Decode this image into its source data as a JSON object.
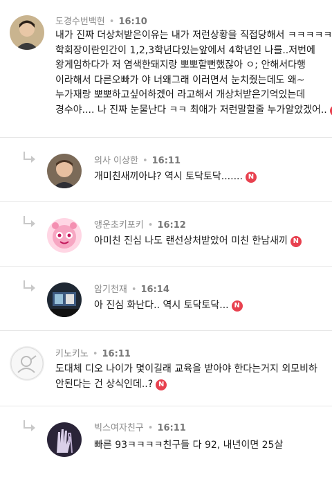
{
  "colors": {
    "badge": "#e8414f",
    "meta": "#8a8a8a",
    "divider": "#e6e6e6"
  },
  "comments": [
    {
      "author": "도경수번백현",
      "time": "16:10",
      "is_reply": false,
      "avatar": "person-photo",
      "lines": [
        "내가 진짜 더상처받은이유는 내가 저런상황을 직접당해서 ㅋㅋㅋㅋㅋ",
        "학회장이란인간이 1,2,3학년다있는앞에서 4학년인 나를..저번에",
        "왕게임하다가 저 염색한돼지랑 뽀뽀할뻔했잖아 ㅇ; 안해서다행",
        "이라해서 다른오빠가 야 너왜그래 이러면서 눈치줬는데도 왜~",
        "누가재랑 뽀뽀하고싶어하겠어 라고해서 개상처받은기억있는데",
        "경수야.... 나 진짜 눈물난다 ㅋㅋ 최애가 저런말할줄 누가알았겠어.."
      ],
      "badge": "N"
    },
    {
      "author": "의사 이상한",
      "time": "16:11",
      "is_reply": true,
      "avatar": "person-photo",
      "lines": [
        "개미친새끼아냐? 역시 토닥토닥......."
      ],
      "badge": "N"
    },
    {
      "author": "앵운초키포키",
      "time": "16:12",
      "is_reply": true,
      "avatar": "pink-cartoon",
      "lines": [
        "아미친 진심 나도 랜선상처받았어 미친 한남새끼"
      ],
      "badge": "N"
    },
    {
      "author": "암기천재",
      "time": "16:14",
      "is_reply": true,
      "avatar": "dark-photo",
      "lines": [
        "아 진심 화난다.. 역시 토닥토닥..."
      ],
      "badge": "N"
    },
    {
      "author": "키노키노",
      "time": "16:11",
      "is_reply": false,
      "avatar": "default-gray",
      "lines": [
        "도대체 디오 나이가 몇이길래 교육을 받아야 한다는거지 외모비하",
        "안된다는 건 상식인데..?"
      ],
      "badge": "N"
    },
    {
      "author": "빅스여자친구",
      "time": "16:11",
      "is_reply": true,
      "avatar": "hands-photo",
      "lines": [
        "빠른 93ㅋㅋㅋㅋ친구들 다 92, 내년이면 25살"
      ],
      "badge": "N"
    }
  ]
}
